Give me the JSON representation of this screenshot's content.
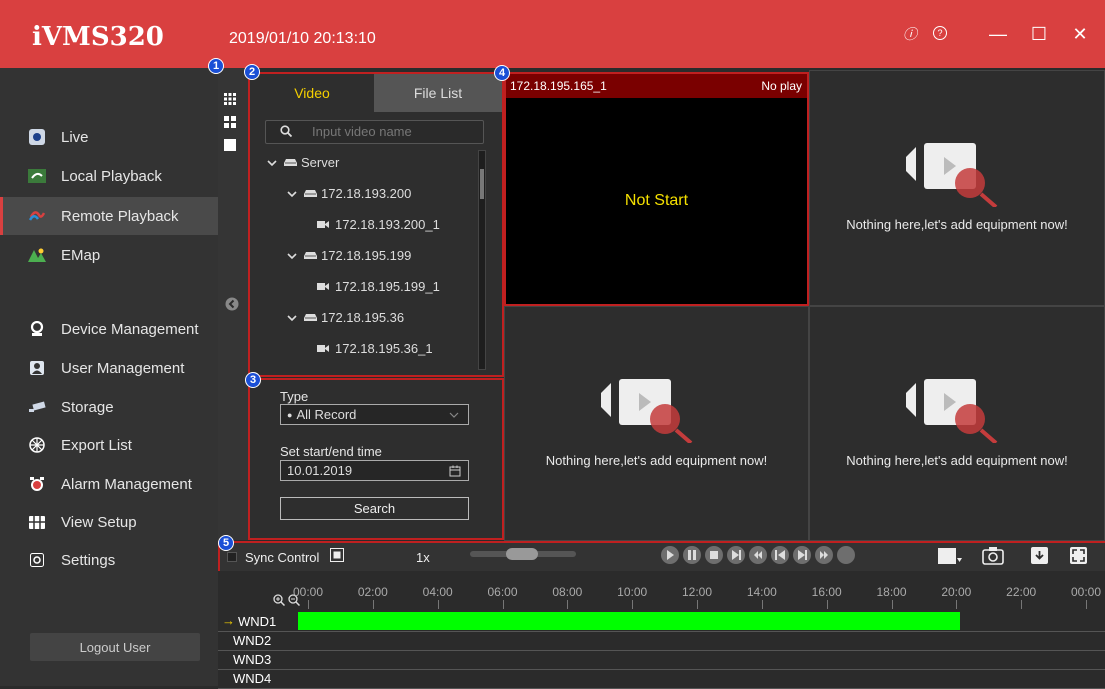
{
  "app": {
    "title": "iVMS320",
    "datetime": "2019/01/10 20:13:10"
  },
  "window_controls": {
    "info": "ⓘ",
    "help": "?",
    "minimize": "—",
    "maximize": "☐",
    "close": "✕"
  },
  "sidebar": {
    "items": [
      {
        "label": "Live",
        "icon": "live-icon"
      },
      {
        "label": "Local Playback",
        "icon": "local-playback-icon"
      },
      {
        "label": "Remote Playback",
        "icon": "remote-playback-icon",
        "active": true
      },
      {
        "label": "EMap",
        "icon": "emap-icon"
      },
      {
        "label": "Device Management",
        "icon": "device-management-icon"
      },
      {
        "label": "User Management",
        "icon": "user-management-icon"
      },
      {
        "label": "Storage",
        "icon": "storage-icon"
      },
      {
        "label": "Export List",
        "icon": "export-list-icon"
      },
      {
        "label": "Alarm Management",
        "icon": "alarm-icon"
      },
      {
        "label": "View Setup",
        "icon": "view-setup-icon"
      },
      {
        "label": "Settings",
        "icon": "settings-icon"
      }
    ],
    "logout": "Logout User"
  },
  "badges": [
    "1",
    "2",
    "3",
    "4",
    "5"
  ],
  "device_panel": {
    "tabs": [
      "Video",
      "File List"
    ],
    "active_tab": "Video",
    "search_placeholder": "Input video name",
    "tree": [
      {
        "label": "Server",
        "level": 0
      },
      {
        "label": "172.18.193.200",
        "level": 1
      },
      {
        "label": "172.18.193.200_1",
        "level": 2
      },
      {
        "label": "172.18.195.199",
        "level": 1
      },
      {
        "label": "172.18.195.199_1",
        "level": 2
      },
      {
        "label": "172.18.195.36",
        "level": 1
      },
      {
        "label": "172.18.195.36_1",
        "level": 2
      }
    ]
  },
  "search_panel": {
    "type_label": "Type",
    "type_value": "All Record",
    "time_label": "Set start/end time",
    "time_value": "10.01.2019",
    "search_button": "Search"
  },
  "video_grid": {
    "active_cell": {
      "name": "172.18.195.165_1",
      "status": "No play",
      "center_text": "Not Start"
    },
    "empty_message": "Nothing here,let's add equipment now!"
  },
  "timeline": {
    "sync_control": "Sync Control",
    "speed": "1x",
    "hours": [
      "00:00",
      "02:00",
      "04:00",
      "06:00",
      "08:00",
      "10:00",
      "12:00",
      "14:00",
      "16:00",
      "18:00",
      "20:00",
      "22:00",
      "00:00"
    ],
    "windows": [
      "WND1",
      "WND2",
      "WND3",
      "WND4"
    ],
    "recording": {
      "window": "WND1",
      "start_hour": 0,
      "end_hour": 20.1
    },
    "record_color": "#00ff00"
  },
  "colors": {
    "accent": "#d94040",
    "frame": "#c02020",
    "badge": "#1a4fd6"
  }
}
